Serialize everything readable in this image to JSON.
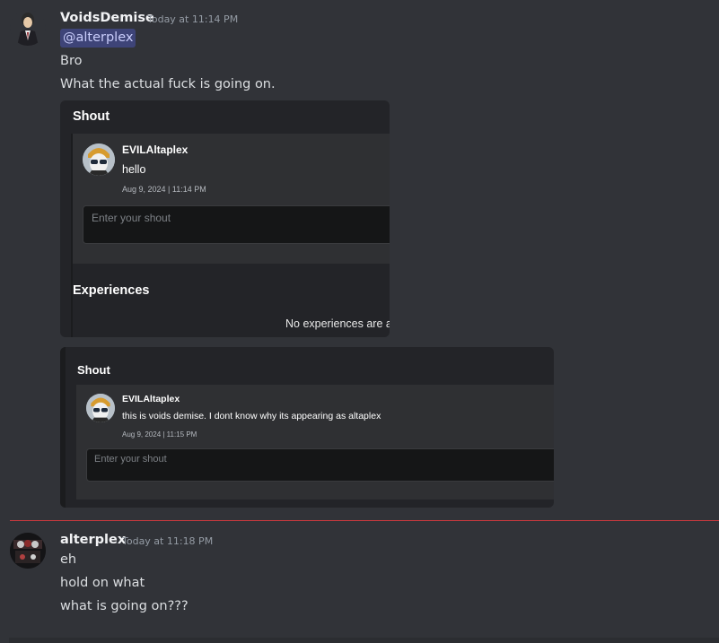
{
  "messages": [
    {
      "username": "VoidsDemise",
      "timestamp": "Today at 11:14 PM",
      "mention": "@alterplex",
      "lines": [
        "Bro",
        "What the actual fuck is going on."
      ]
    },
    {
      "username": "alterplex",
      "timestamp": "Today at 11:18 PM",
      "lines": [
        "eh",
        "hold on what",
        "what is going on???"
      ]
    }
  ],
  "attachment1": {
    "shout_title": "Shout",
    "post": {
      "author": "EVILAltaplex",
      "text": "hello",
      "date": "Aug 9, 2024 | 11:14 PM"
    },
    "input_placeholder": "Enter your shout",
    "experiences_title": "Experiences",
    "experiences_empty": "No experiences are a"
  },
  "attachment2": {
    "shout_title": "Shout",
    "post": {
      "author": "EVILAltaplex",
      "text": "this is voids demise. I dont know why its appearing as altaplex",
      "date": "Aug 9, 2024 | 11:15 PM"
    },
    "input_placeholder": "Enter your shout"
  },
  "colors": {
    "background": "#313338",
    "new_messages_divider": "#c9393e",
    "mention_bg": "#3c4270"
  }
}
